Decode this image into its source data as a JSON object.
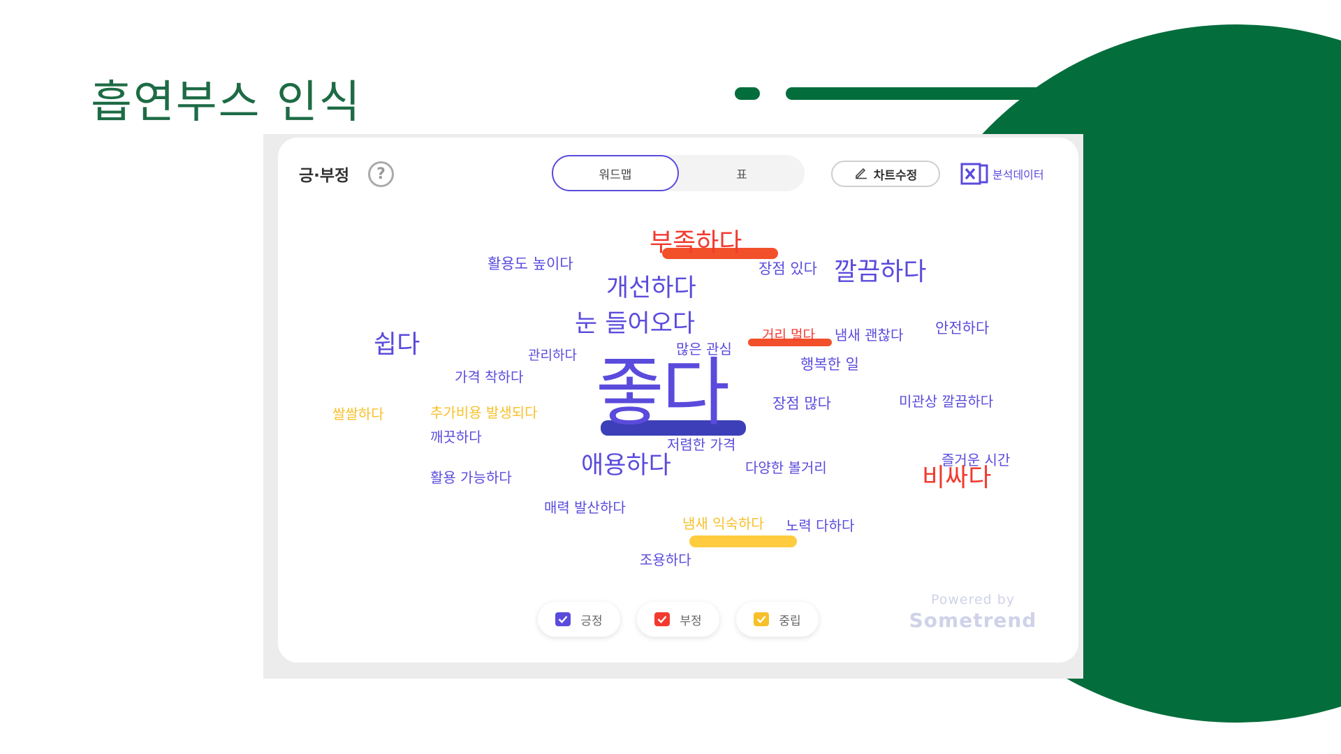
{
  "colors": {
    "green": "#036d3c",
    "title": "#1d6b45",
    "positive": "#5a4bdc",
    "negative": "#f23a2f",
    "neutral": "#f7c02a",
    "neg_mark": "#f2502a",
    "neu_mark": "#ffcc40",
    "main_mark": "#3d3fb8"
  },
  "slide": {
    "title": "흡연부스 인식"
  },
  "panel": {
    "title": "긍·부정",
    "help_icon": "question-circle-icon",
    "tabs": [
      {
        "label": "워드맵",
        "active": true
      },
      {
        "label": "표",
        "active": false
      }
    ],
    "edit_button": {
      "label": "차트수정",
      "icon": "pencil-icon"
    },
    "export_button": {
      "label": "분석데이터",
      "icon": "excel-icon"
    }
  },
  "word_cloud": {
    "words": [
      {
        "text": "부족하다",
        "sentiment": "negative"
      },
      {
        "text": "활용도 높이다",
        "sentiment": "positive"
      },
      {
        "text": "장점 있다",
        "sentiment": "positive"
      },
      {
        "text": "깔끔하다",
        "sentiment": "positive"
      },
      {
        "text": "개선하다",
        "sentiment": "positive"
      },
      {
        "text": "눈 들어오다",
        "sentiment": "positive"
      },
      {
        "text": "거리 멀다",
        "sentiment": "negative"
      },
      {
        "text": "냄새 괜찮다",
        "sentiment": "positive"
      },
      {
        "text": "안전하다",
        "sentiment": "positive"
      },
      {
        "text": "쉽다",
        "sentiment": "positive"
      },
      {
        "text": "관리하다",
        "sentiment": "positive"
      },
      {
        "text": "많은 관심",
        "sentiment": "positive"
      },
      {
        "text": "행복한 일",
        "sentiment": "positive"
      },
      {
        "text": "가격 착하다",
        "sentiment": "positive"
      },
      {
        "text": "좋다",
        "sentiment": "positive"
      },
      {
        "text": "장점 많다",
        "sentiment": "positive"
      },
      {
        "text": "미관상 깔끔하다",
        "sentiment": "positive"
      },
      {
        "text": "쌀쌀하다",
        "sentiment": "neutral"
      },
      {
        "text": "추가비용 발생되다",
        "sentiment": "neutral"
      },
      {
        "text": "깨끗하다",
        "sentiment": "positive"
      },
      {
        "text": "저렴한 가격",
        "sentiment": "positive"
      },
      {
        "text": "즐거운 시간",
        "sentiment": "positive"
      },
      {
        "text": "애용하다",
        "sentiment": "positive"
      },
      {
        "text": "다양한 볼거리",
        "sentiment": "positive"
      },
      {
        "text": "비싸다",
        "sentiment": "negative"
      },
      {
        "text": "활용 가능하다",
        "sentiment": "positive"
      },
      {
        "text": "매력 발산하다",
        "sentiment": "positive"
      },
      {
        "text": "냄새 익숙하다",
        "sentiment": "neutral"
      },
      {
        "text": "노력 다하다",
        "sentiment": "positive"
      },
      {
        "text": "조용하다",
        "sentiment": "positive"
      }
    ]
  },
  "legend": [
    {
      "label": "긍정",
      "sentiment": "positive",
      "checked": true
    },
    {
      "label": "부정",
      "sentiment": "negative",
      "checked": true
    },
    {
      "label": "중립",
      "sentiment": "neutral",
      "checked": true
    }
  ],
  "powered_by": {
    "line1": "Powered by",
    "line2": "Sometrend"
  }
}
